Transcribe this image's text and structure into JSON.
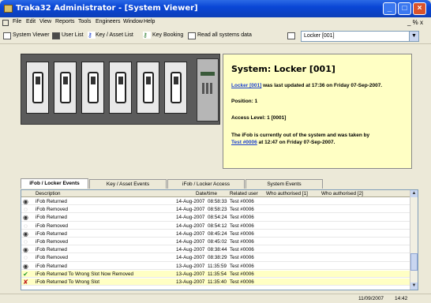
{
  "window": {
    "title": "Traka32 Administrator - [System Viewer]"
  },
  "menu": [
    "File",
    "Edit",
    "View",
    "Reports",
    "Tools",
    "Engineers",
    "Window",
    "Help"
  ],
  "mdi_controls": "_ % x",
  "toolbar": {
    "system_viewer": "System Viewer",
    "user_list": "User List",
    "key_asset_list": "Key / Asset List",
    "key_booking": "Key Booking",
    "read_all": "Read all systems data",
    "locker_select": "Locker [001]"
  },
  "info": {
    "title": "System: Locker [001]",
    "updated_link": "Locker [001]",
    "updated_text": "was last updated at 17:36 on Friday 07-Sep-2007.",
    "position": "Position: 1",
    "access_level": "Access Level: 1 [0001]",
    "status_line1": "The iFob is currently out of the system and was taken by",
    "taken_by": "Test #0006",
    "status_line2": "at 12:47 on Friday 07-Sep-2007."
  },
  "tabs": [
    "iFob / Locker Events",
    "Key / Asset Events",
    "iFob / Locker Access",
    "System Events"
  ],
  "columns": [
    "Description",
    "Date/time",
    "Related user",
    "Who authorised [1]",
    "Who authorised [2]"
  ],
  "rows": [
    {
      "desc": "iFob Returned",
      "date": "14-Aug-2007",
      "time": "08:58:33",
      "user": "Test #0006",
      "icon": "returned"
    },
    {
      "desc": "iFob Removed",
      "date": "14-Aug-2007",
      "time": "08:58:23",
      "user": "Test #0006",
      "icon": "removed"
    },
    {
      "desc": "iFob Returned",
      "date": "14-Aug-2007",
      "time": "08:54:24",
      "user": "Test #0006",
      "icon": "returned"
    },
    {
      "desc": "iFob Removed",
      "date": "14-Aug-2007",
      "time": "08:54:12",
      "user": "Test #0006",
      "icon": "removed"
    },
    {
      "desc": "iFob Returned",
      "date": "14-Aug-2007",
      "time": "08:45:24",
      "user": "Test #0006",
      "icon": "returned"
    },
    {
      "desc": "iFob Removed",
      "date": "14-Aug-2007",
      "time": "08:45:02",
      "user": "Test #0006",
      "icon": "removed"
    },
    {
      "desc": "iFob Returned",
      "date": "14-Aug-2007",
      "time": "08:38:44",
      "user": "Test #0006",
      "icon": "returned"
    },
    {
      "desc": "iFob Removed",
      "date": "14-Aug-2007",
      "time": "08:38:29",
      "user": "Test #0006",
      "icon": "removed"
    },
    {
      "desc": "iFob Returned",
      "date": "13-Aug-2007",
      "time": "11:35:59",
      "user": "Test #0006",
      "icon": "returned"
    },
    {
      "desc": "iFob Returned To Wrong Slot Now Removed",
      "date": "13-Aug-2007",
      "time": "11:35:54",
      "user": "Test #0006",
      "icon": "check",
      "hl": true
    },
    {
      "desc": "iFob Returned To Wrong Slot",
      "date": "13-Aug-2007",
      "time": "11:35:40",
      "user": "Test #0006",
      "icon": "cross",
      "hl": true
    }
  ],
  "status": {
    "date": "11/09/2007",
    "time": "14:42"
  }
}
